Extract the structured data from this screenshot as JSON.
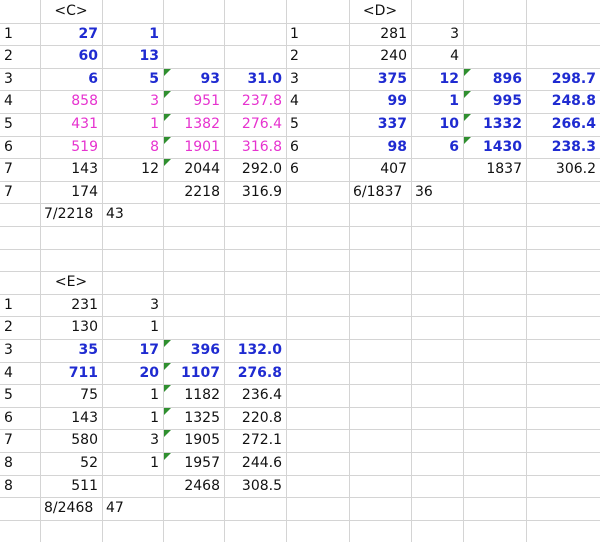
{
  "blocks": [
    {
      "header": "<C>",
      "rows": [
        {
          "n": "1",
          "a": "27",
          "b": "1",
          "c": "",
          "d": "",
          "style": "blue",
          "flag": false
        },
        {
          "n": "2",
          "a": "60",
          "b": "13",
          "c": "",
          "d": "",
          "style": "blue",
          "flag": false
        },
        {
          "n": "3",
          "a": "6",
          "b": "5",
          "c": "93",
          "d": "31.0",
          "style": "blue",
          "flag": true
        },
        {
          "n": "4",
          "a": "858",
          "b": "3",
          "c": "951",
          "d": "237.8",
          "style": "pink",
          "flag": true
        },
        {
          "n": "5",
          "a": "431",
          "b": "1",
          "c": "1382",
          "d": "276.4",
          "style": "pink",
          "flag": true
        },
        {
          "n": "6",
          "a": "519",
          "b": "8",
          "c": "1901",
          "d": "316.8",
          "style": "pink",
          "flag": true
        },
        {
          "n": "7",
          "a": "143",
          "b": "12",
          "c": "2044",
          "d": "292.0",
          "style": "black",
          "flag": true
        },
        {
          "n": "7",
          "a": "174",
          "b": "",
          "c": "2218",
          "d": "316.9",
          "style": "black",
          "flag": false
        }
      ],
      "footer": {
        "label": "7/2218",
        "count": "43"
      }
    },
    {
      "header": "<D>",
      "rows": [
        {
          "n": "1",
          "a": "281",
          "b": "3",
          "c": "",
          "d": "",
          "style": "black",
          "flag": false
        },
        {
          "n": "2",
          "a": "240",
          "b": "4",
          "c": "",
          "d": "",
          "style": "black",
          "flag": false
        },
        {
          "n": "3",
          "a": "375",
          "b": "12",
          "c": "896",
          "d": "298.7",
          "style": "blue",
          "flag": true
        },
        {
          "n": "4",
          "a": "99",
          "b": "1",
          "c": "995",
          "d": "248.8",
          "style": "blue",
          "flag": true
        },
        {
          "n": "5",
          "a": "337",
          "b": "10",
          "c": "1332",
          "d": "266.4",
          "style": "blue",
          "flag": true
        },
        {
          "n": "6",
          "a": "98",
          "b": "6",
          "c": "1430",
          "d": "238.3",
          "style": "blue",
          "flag": true
        },
        {
          "n": "6",
          "a": "407",
          "b": "",
          "c": "1837",
          "d": "306.2",
          "style": "black",
          "flag": false
        }
      ],
      "footer": {
        "label": "6/1837",
        "count": "36"
      }
    },
    {
      "header": "<E>",
      "rows": [
        {
          "n": "1",
          "a": "231",
          "b": "3",
          "c": "",
          "d": "",
          "style": "black",
          "flag": false
        },
        {
          "n": "2",
          "a": "130",
          "b": "1",
          "c": "",
          "d": "",
          "style": "black",
          "flag": false
        },
        {
          "n": "3",
          "a": "35",
          "b": "17",
          "c": "396",
          "d": "132.0",
          "style": "blue",
          "flag": true
        },
        {
          "n": "4",
          "a": "711",
          "b": "20",
          "c": "1107",
          "d": "276.8",
          "style": "blue",
          "flag": true
        },
        {
          "n": "5",
          "a": "75",
          "b": "1",
          "c": "1182",
          "d": "236.4",
          "style": "black",
          "flag": true
        },
        {
          "n": "6",
          "a": "143",
          "b": "1",
          "c": "1325",
          "d": "220.8",
          "style": "black",
          "flag": true
        },
        {
          "n": "7",
          "a": "580",
          "b": "3",
          "c": "1905",
          "d": "272.1",
          "style": "black",
          "flag": true
        },
        {
          "n": "8",
          "a": "52",
          "b": "1",
          "c": "1957",
          "d": "244.6",
          "style": "black",
          "flag": true
        },
        {
          "n": "8",
          "a": "511",
          "b": "",
          "c": "2468",
          "d": "308.5",
          "style": "black",
          "flag": false
        }
      ],
      "footer": {
        "label": "8/2468",
        "count": "47"
      }
    }
  ],
  "colors": {
    "blue": "#1f2bd1",
    "pink": "#e632cf",
    "grid": "#d4d4d4",
    "flag": "#2f8f2f"
  }
}
